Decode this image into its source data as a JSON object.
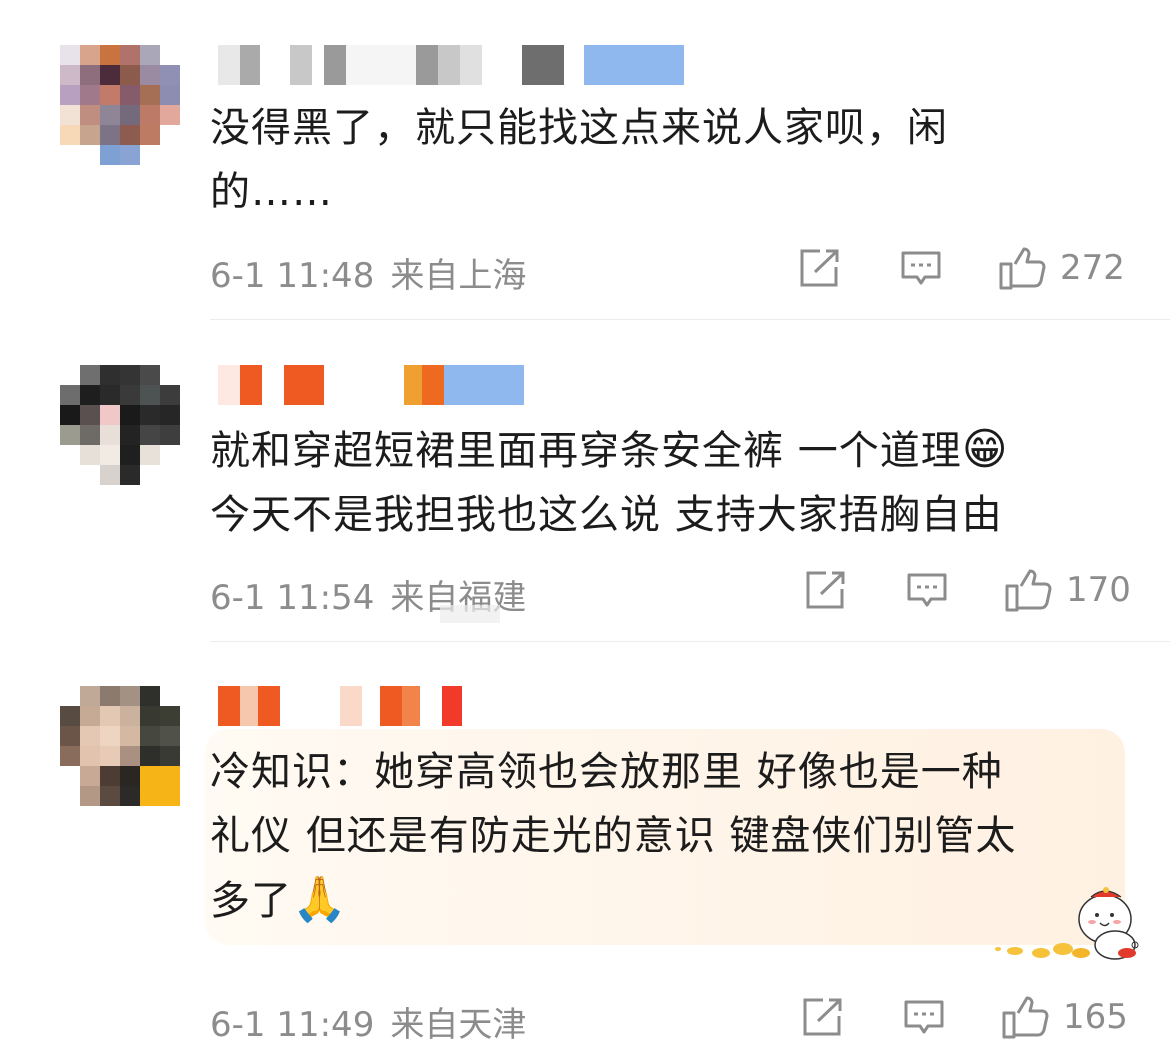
{
  "comments": [
    {
      "text_lines": [
        "没得黑了，就只能找这点来说人家呗，闲",
        "的……"
      ],
      "time": "6-1 11:48",
      "location": "来自上海",
      "likes": "272",
      "emoji": ""
    },
    {
      "text_lines": [
        "就和穿超短裙里面再穿条安全裤 一个道理",
        "今天不是我担我也这么说 支持大家捂胸自由"
      ],
      "time": "6-1 11:54",
      "location": "来自福建",
      "likes": "170",
      "emoji": "😁"
    },
    {
      "text_lines": [
        "冷知识：她穿高领也会放那里 好像也是一种",
        "礼仪 但还是有防走光的意识 键盘侠们别管太",
        "多了"
      ],
      "time": "6-1 11:49",
      "location": "来自天津",
      "likes": "165",
      "emoji": "🙏"
    }
  ],
  "icons": {
    "share": "share-icon",
    "comment": "comment-icon",
    "like": "thumbs-up-icon"
  },
  "colors": {
    "meta_text": "#8c8c8c",
    "body_text": "#1c1c1c",
    "divider": "#ececec"
  }
}
